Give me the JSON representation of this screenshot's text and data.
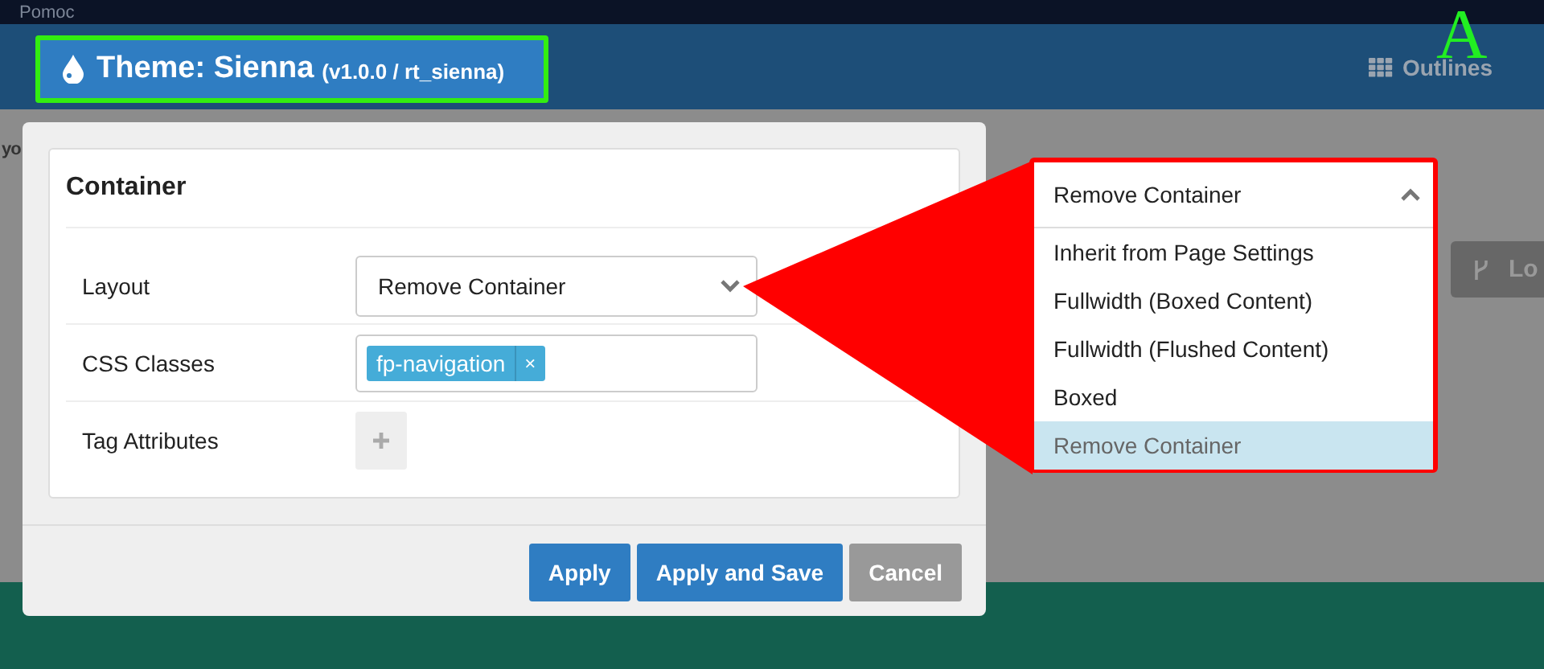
{
  "top_bar": {
    "menu": "Pomoc"
  },
  "header": {
    "theme_title": "Theme: Sienna",
    "theme_version": "(v1.0.0 / rt_sienna)",
    "outlines": "Outlines"
  },
  "annotation_letter": "A",
  "background": {
    "side_text": "yo",
    "button_text": "Lo"
  },
  "modal": {
    "title": "Container",
    "fields": [
      {
        "kind": "select",
        "label": "Layout",
        "value": "Remove Container"
      },
      {
        "kind": "tags",
        "label": "CSS Classes",
        "tags": [
          {
            "label": "fp-navigation",
            "remove": "×"
          }
        ]
      },
      {
        "kind": "add",
        "label": "Tag Attributes"
      }
    ],
    "buttons": [
      {
        "label": "Apply",
        "kind": "primary"
      },
      {
        "label": "Apply and Save",
        "kind": "primary"
      },
      {
        "label": "Cancel",
        "kind": "secondary"
      }
    ]
  },
  "dropdown": {
    "value": "Remove Container",
    "expanded": true,
    "options": [
      {
        "label": "Inherit from Page Settings",
        "selected": false
      },
      {
        "label": "Fullwidth (Boxed Content)",
        "selected": false
      },
      {
        "label": "Fullwidth (Flushed Content)",
        "selected": false
      },
      {
        "label": "Boxed",
        "selected": false
      },
      {
        "label": "Remove Container",
        "selected": true
      }
    ]
  }
}
